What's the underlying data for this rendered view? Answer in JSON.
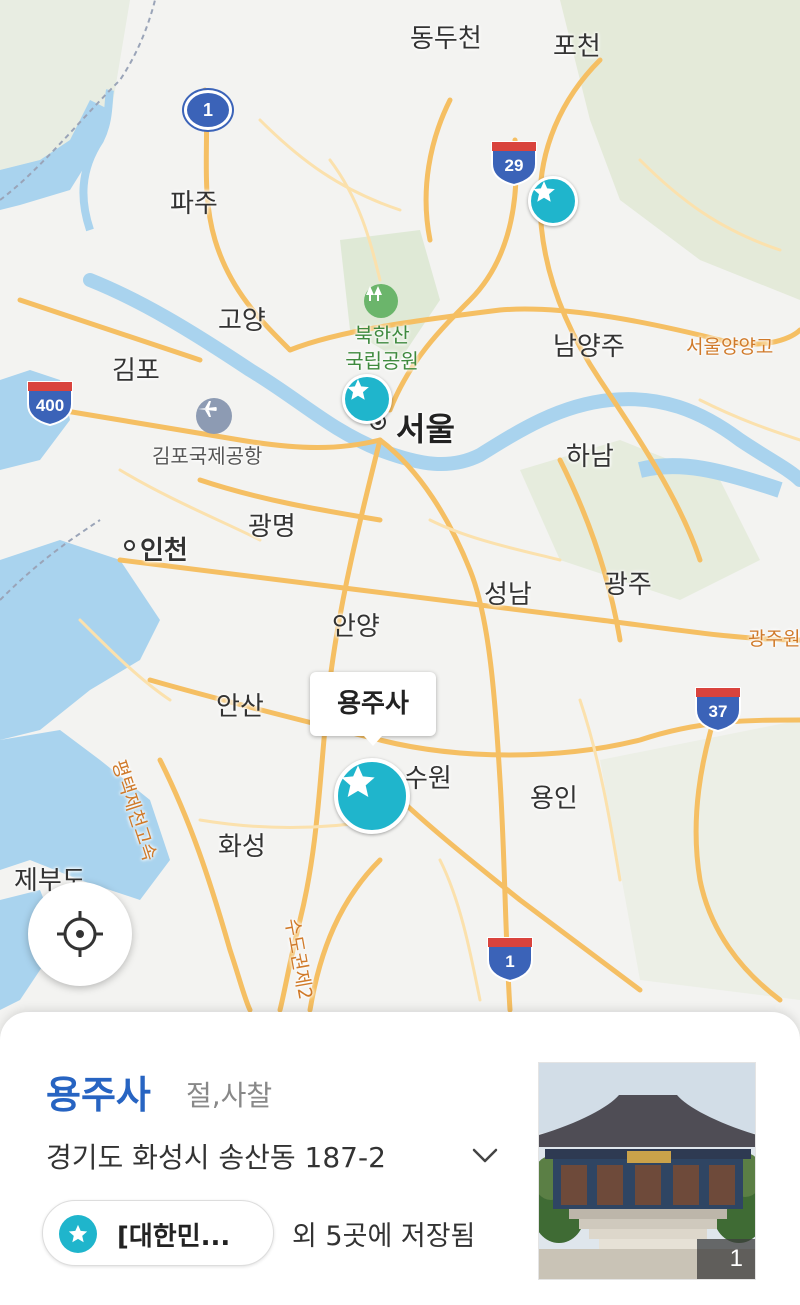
{
  "map": {
    "cities": [
      {
        "id": "dongducheon",
        "label": "동두천"
      },
      {
        "id": "pocheon",
        "label": "포천"
      },
      {
        "id": "paju",
        "label": "파주"
      },
      {
        "id": "goyang",
        "label": "고양"
      },
      {
        "id": "gimpo",
        "label": "김포"
      },
      {
        "id": "namyangju",
        "label": "남양주"
      },
      {
        "id": "seoul",
        "label": "서울"
      },
      {
        "id": "hanam",
        "label": "하남"
      },
      {
        "id": "gwangmyeong",
        "label": "광명"
      },
      {
        "id": "incheon",
        "label": "인천"
      },
      {
        "id": "seongnam",
        "label": "성남"
      },
      {
        "id": "gwangju",
        "label": "광주"
      },
      {
        "id": "anyang",
        "label": "안양"
      },
      {
        "id": "ansan",
        "label": "안산"
      },
      {
        "id": "suwon",
        "label": "수원"
      },
      {
        "id": "yongin",
        "label": "용인"
      },
      {
        "id": "hwaseong",
        "label": "화성"
      },
      {
        "id": "jebudo",
        "label": "제부도"
      }
    ],
    "park_label_line1": "북한산",
    "park_label_line2": "국립공원",
    "airport_label": "김포국제공항",
    "expressway_labels": {
      "seoul_yangyang": "서울양양고",
      "gwangju_won": "광주원",
      "pyeongtaek_jecheon": "평택제천고속",
      "second_ring": "수도권제2"
    },
    "route_shields": [
      {
        "id": "route-1-north",
        "number": "1",
        "kind": "national"
      },
      {
        "id": "route-29",
        "number": "29",
        "kind": "interstate"
      },
      {
        "id": "route-400",
        "number": "400",
        "kind": "interstate"
      },
      {
        "id": "route-37",
        "number": "37",
        "kind": "interstate"
      },
      {
        "id": "route-1-south",
        "number": "1",
        "kind": "interstate"
      }
    ],
    "selected_pin_callout": "용주사",
    "colors": {
      "land": "#f3f3f1",
      "water": "#a9d3ee",
      "road_major": "#f5bf63",
      "park": "#dfe9d6",
      "pin": "#1fb5cc",
      "shield": "#3b63b8"
    }
  },
  "place": {
    "name": "용주사",
    "category": "절,사찰",
    "address": "경기도 화성시 송산동 187-2",
    "saved_list_label": "[대한민...",
    "saved_count_text": "외 5곳에 저장됨",
    "photo_count": "1"
  },
  "icons": {
    "locate": "crosshair-icon",
    "star": "star-icon",
    "expand": "chevron-down-icon",
    "park": "tree-icon",
    "airport": "airplane-icon"
  }
}
